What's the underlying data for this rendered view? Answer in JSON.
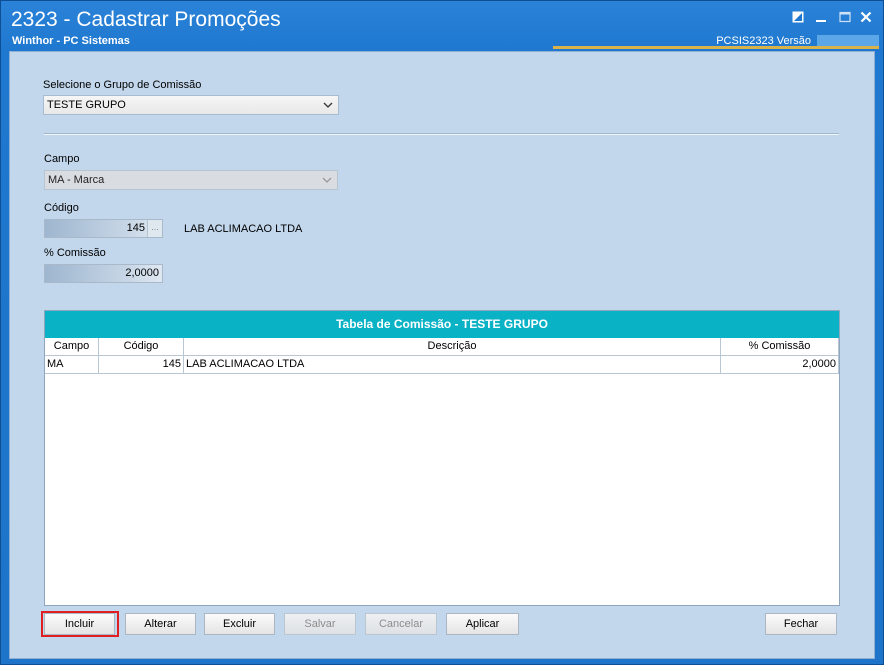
{
  "window": {
    "title": "2323 - Cadastrar Promoções",
    "subtitle": "Winthor - PC Sistemas",
    "version_label": "PCSIS2323  Versão"
  },
  "form": {
    "grupo_label": "Selecione o Grupo de Comissão",
    "grupo_value": "TESTE GRUPO",
    "campo_label": "Campo",
    "campo_value": "MA - Marca",
    "codigo_label": "Código",
    "codigo_value": "145",
    "codigo_lookup": "...",
    "codigo_desc": "LAB ACLIMACAO LTDA",
    "comissao_label": "% Comissão",
    "comissao_value": "2,0000"
  },
  "table": {
    "title": "Tabela de Comissão - TESTE GRUPO",
    "columns": [
      "Campo",
      "Código",
      "Descrição",
      "% Comissão"
    ],
    "rows": [
      [
        "MA",
        "145",
        "LAB ACLIMACAO LTDA",
        "2,0000"
      ]
    ]
  },
  "buttons": {
    "incluir": "Incluir",
    "alterar": "Alterar",
    "excluir": "Excluir",
    "salvar": "Salvar",
    "cancelar": "Cancelar",
    "aplicar": "Aplicar",
    "fechar": "Fechar"
  },
  "icons": [
    "note-icon",
    "minimize-icon",
    "maximize-icon",
    "close-icon",
    "chevron-down-icon"
  ],
  "colors": {
    "titlebar": "#1f78cf",
    "content_bg": "#c2d7ec",
    "table_header": "#0ab2c6",
    "highlight": "#e02020"
  }
}
